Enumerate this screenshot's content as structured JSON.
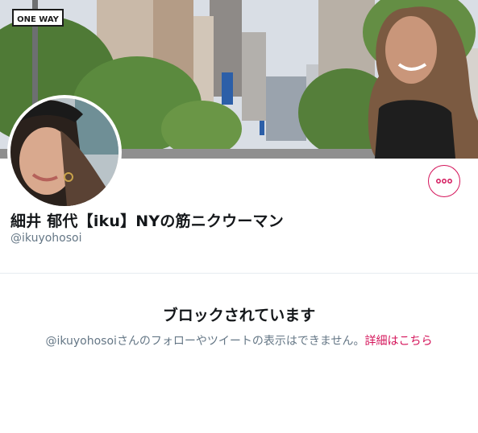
{
  "profile": {
    "display_name": "細井 郁代【iku】NYの筋ニクウーマン",
    "handle": "@ikuyohosoi"
  },
  "banner": {
    "street_sign_text": "ONE WAY"
  },
  "more_button": {
    "icon": "more-horizontal-icon"
  },
  "blocked": {
    "title": "ブロックされています",
    "message_handle": "@ikuyohosoi",
    "message": "さんのフォローやツイートの表示はできません。",
    "details_link": "詳細はこちら"
  },
  "colors": {
    "accent": "#d4145a",
    "secondary_text": "#657786",
    "primary_text": "#14171a",
    "divider": "#e6ecf0"
  }
}
